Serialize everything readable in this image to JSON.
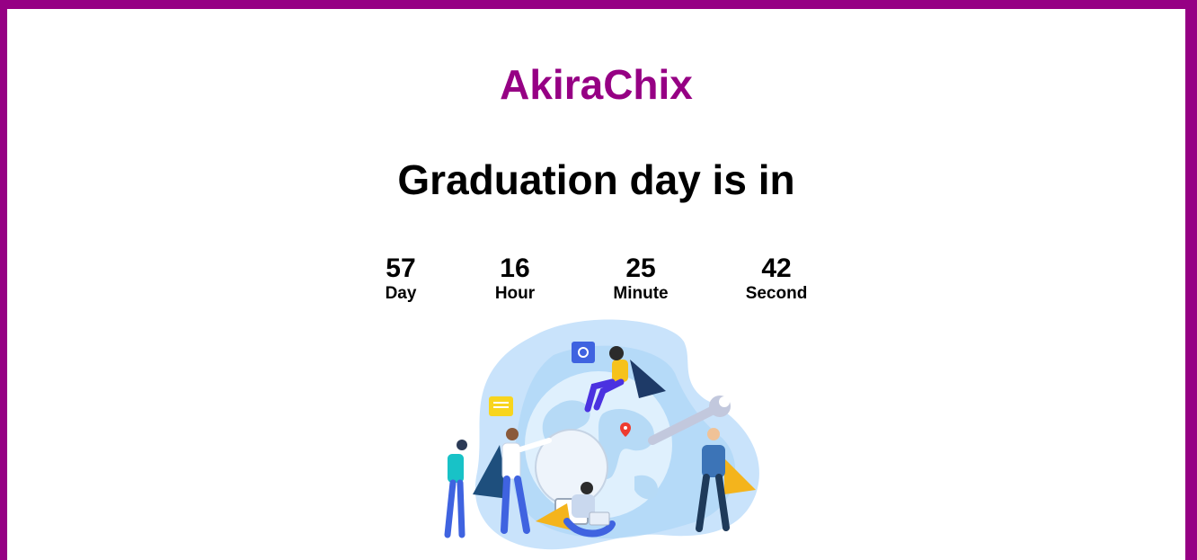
{
  "brand": "AkiraChix",
  "headline": "Graduation day is in",
  "countdown": [
    {
      "value": "57",
      "label": "Day"
    },
    {
      "value": "16",
      "label": "Hour"
    },
    {
      "value": "25",
      "label": "Minute"
    },
    {
      "value": "42",
      "label": "Second"
    }
  ],
  "colors": {
    "brand": "#960084",
    "background": "#ffffff"
  },
  "illustration": {
    "icon": "teamwork-globe-illustration"
  }
}
